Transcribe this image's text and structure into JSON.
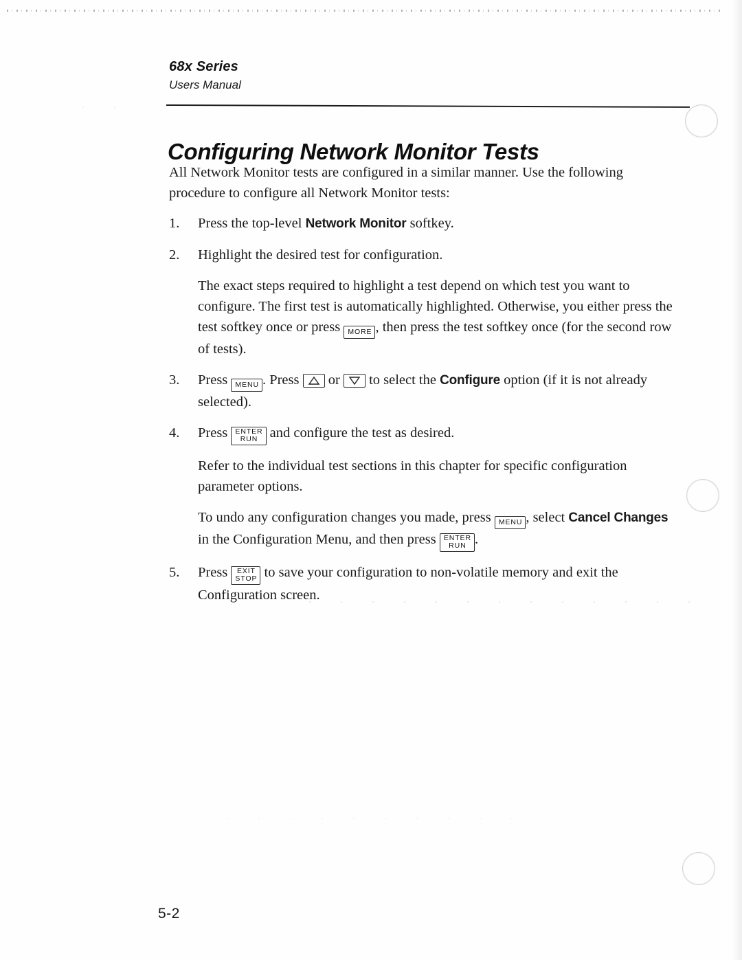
{
  "header": {
    "series": "68x Series",
    "manual": "Users Manual"
  },
  "title": "Configuring Network Monitor Tests",
  "intro": {
    "line": "All Network Monitor tests are configured in a similar manner.  Use the following procedure to configure all Network Monitor tests:"
  },
  "steps": [
    {
      "num": "1.",
      "pre": "Press the top-level ",
      "bold": "Network Monitor",
      "post": " softkey."
    },
    {
      "num": "2.",
      "text": "Highlight the desired test for configuration."
    },
    {
      "num": "3.",
      "p1": "Press ",
      "p2": ".  Press ",
      "p3": " or ",
      "p4": " to select the ",
      "bold": "Configure",
      "p5": " option (if it is not already selected)."
    },
    {
      "num": "4.",
      "p1": "Press ",
      "p2": " and configure the test as desired."
    },
    {
      "num": "5.",
      "p1": "Press ",
      "p2": " to save your configuration to non-volatile memory and exit the Configuration screen."
    }
  ],
  "substeps": {
    "highlight_note": {
      "p1": "The exact steps required to highlight a test depend on which test you want to configure.  The first test is automatically highlighted.  Otherwise, you either press the test softkey once or press ",
      "p2": ", then press the test softkey once (for the second row of tests)."
    },
    "refer_note": "Refer to the individual test sections in this chapter for specific configuration parameter options.",
    "undo_note": {
      "p1": "To undo any configuration changes you made, press ",
      "p2": ", select ",
      "bold": "Cancel Changes",
      "p3": " in the Configuration Menu, and then press ",
      "p4": "."
    }
  },
  "keys": {
    "more": "MORE",
    "menu": "MENU",
    "enter": "ENTER",
    "run": "RUN",
    "exit": "EXIT",
    "stop": "STOP",
    "up_arrow": "up-arrow-key",
    "down_arrow": "down-arrow-key"
  },
  "footer": {
    "page_number": "5-2"
  }
}
